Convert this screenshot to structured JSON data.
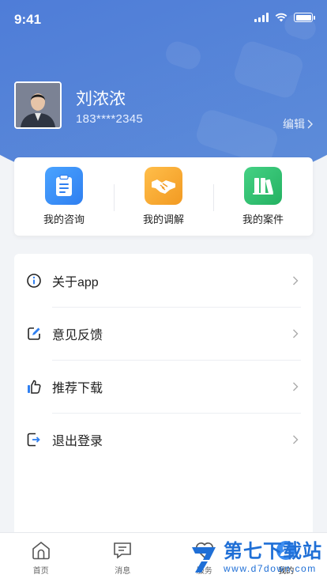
{
  "status_bar": {
    "time": "9:41"
  },
  "profile": {
    "name": "刘浓浓",
    "phone": "183****2345",
    "edit_label": "编辑"
  },
  "quick_actions": [
    {
      "label": "我的咨询",
      "icon": "clipboard-icon",
      "color": "#3b8cf0"
    },
    {
      "label": "我的调解",
      "icon": "handshake-icon",
      "color": "#f3a333"
    },
    {
      "label": "我的案件",
      "icon": "books-icon",
      "color": "#2fbf6e"
    }
  ],
  "menu": [
    {
      "label": "关于app",
      "icon": "info-icon"
    },
    {
      "label": "意见反馈",
      "icon": "edit-icon"
    },
    {
      "label": "推荐下载",
      "icon": "thumbs-up-icon"
    },
    {
      "label": "退出登录",
      "icon": "logout-icon"
    }
  ],
  "tabs": [
    {
      "label": "首页",
      "icon": "home-icon"
    },
    {
      "label": "消息",
      "icon": "message-icon"
    },
    {
      "label": "服务",
      "icon": "heart-icon"
    },
    {
      "label": "我的",
      "icon": "profile-icon",
      "active": true
    }
  ],
  "watermark": {
    "title": "第七下载站",
    "url": "www.d7down.com"
  },
  "colors": {
    "brand_blue": "#4a7ddc",
    "accent_blue": "#3b8cf0"
  }
}
